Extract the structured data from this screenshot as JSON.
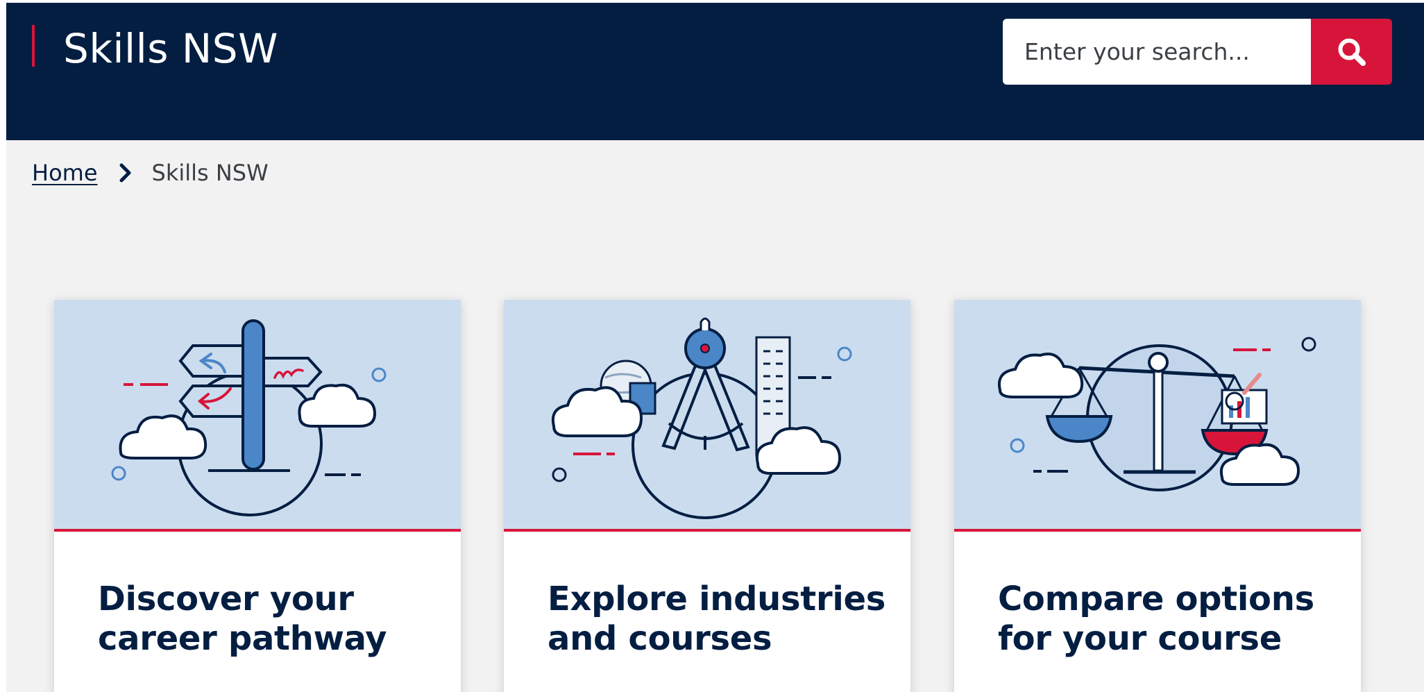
{
  "header": {
    "site_title": "Skills NSW",
    "search": {
      "placeholder": "Enter your search...",
      "value": "",
      "button_icon": "search-icon"
    }
  },
  "breadcrumb": {
    "home_label": "Home",
    "separator_icon": "chevron-right-icon",
    "current_label": "Skills NSW"
  },
  "cards": [
    {
      "title": "Discover your career pathway",
      "illustration": "signpost-illustration"
    },
    {
      "title": "Explore industries and courses",
      "illustration": "compass-illustration"
    },
    {
      "title": "Compare options for your course",
      "illustration": "scales-illustration"
    }
  ],
  "colors": {
    "header_navy": "#041e42",
    "accent_red": "#d7153a",
    "page_bg": "#f2f2f2",
    "illustration_bg": "#cbdcee",
    "illustration_blue": "#4a86c8"
  }
}
